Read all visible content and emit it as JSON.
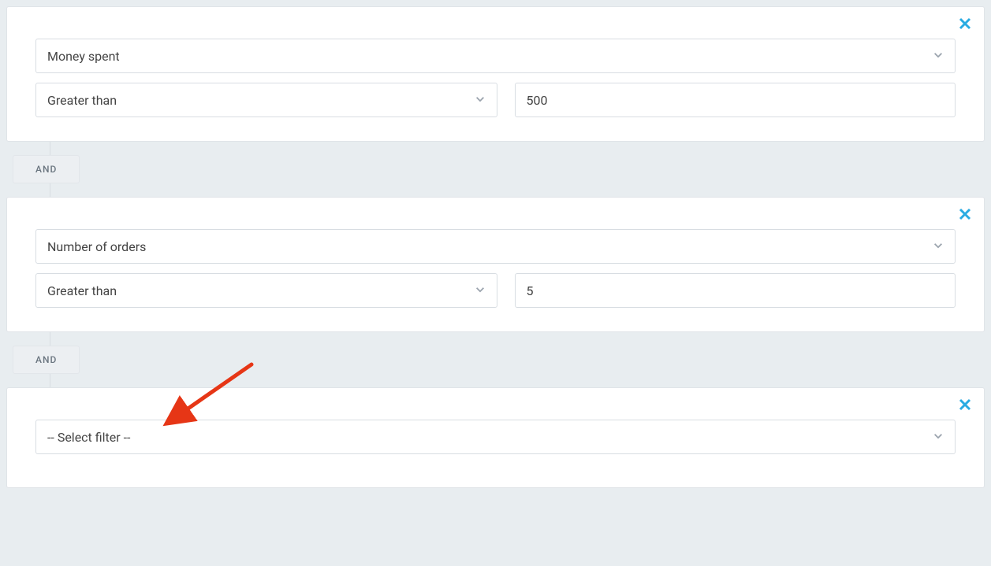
{
  "filters": [
    {
      "attribute": "Money spent",
      "operator": "Greater than",
      "value": "500"
    },
    {
      "attribute": "Number of orders",
      "operator": "Greater than",
      "value": "5"
    },
    {
      "attribute": "-- Select filter --",
      "operator": null,
      "value": null
    }
  ],
  "connector_label": "AND",
  "annotation": {
    "type": "arrow",
    "color": "#e63616"
  }
}
